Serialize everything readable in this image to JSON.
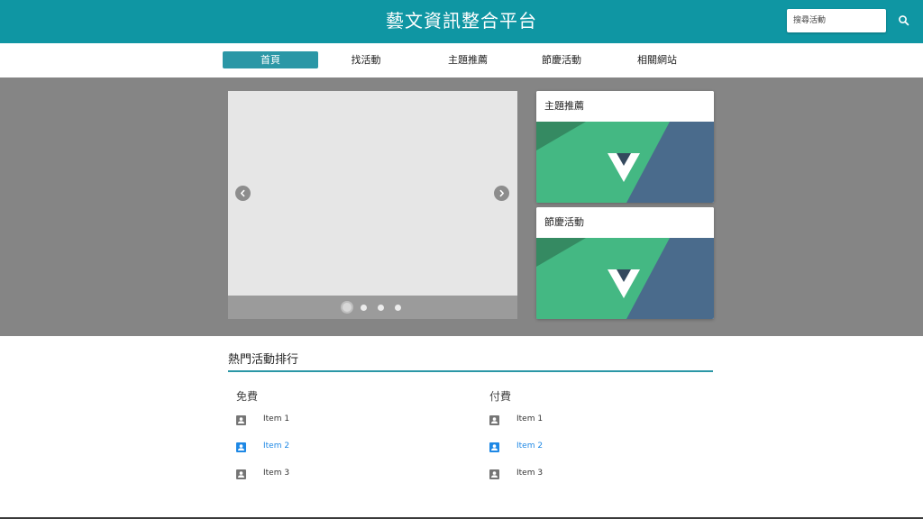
{
  "header": {
    "title": "藝文資訊整合平台",
    "search_placeholder": "搜尋活動",
    "search_icon": "search-icon",
    "background_color": "#0f96a3"
  },
  "nav": {
    "items": [
      {
        "label": "首頁",
        "active": true
      },
      {
        "label": "找活動",
        "active": false
      },
      {
        "label": "主題推薦",
        "active": false
      },
      {
        "label": "節慶活動",
        "active": false
      },
      {
        "label": "相關網站",
        "active": false
      }
    ],
    "active_color": "#2b97a6"
  },
  "carousel": {
    "prev_icon": "chevron-left-icon",
    "next_icon": "chevron-right-icon",
    "slide_count": 4,
    "active_index": 0
  },
  "cards": [
    {
      "title": "主題推薦",
      "image_icon": "vue-logo-icon"
    },
    {
      "title": "節慶活動",
      "image_icon": "vue-logo-icon"
    }
  ],
  "ranking": {
    "title": "熱門活動排行",
    "columns": [
      {
        "title": "免費",
        "items": [
          {
            "label": "Item 1",
            "icon": "account-box-icon",
            "selected": false
          },
          {
            "label": "Item 2",
            "icon": "account-box-icon",
            "selected": true
          },
          {
            "label": "Item 3",
            "icon": "account-box-icon",
            "selected": false
          }
        ]
      },
      {
        "title": "付費",
        "items": [
          {
            "label": "Item 1",
            "icon": "account-box-icon",
            "selected": false
          },
          {
            "label": "Item 2",
            "icon": "account-box-icon",
            "selected": true
          },
          {
            "label": "Item 3",
            "icon": "account-box-icon",
            "selected": false
          }
        ]
      }
    ],
    "accent_color": "#2b97a6",
    "selected_color": "#1e88e5"
  }
}
